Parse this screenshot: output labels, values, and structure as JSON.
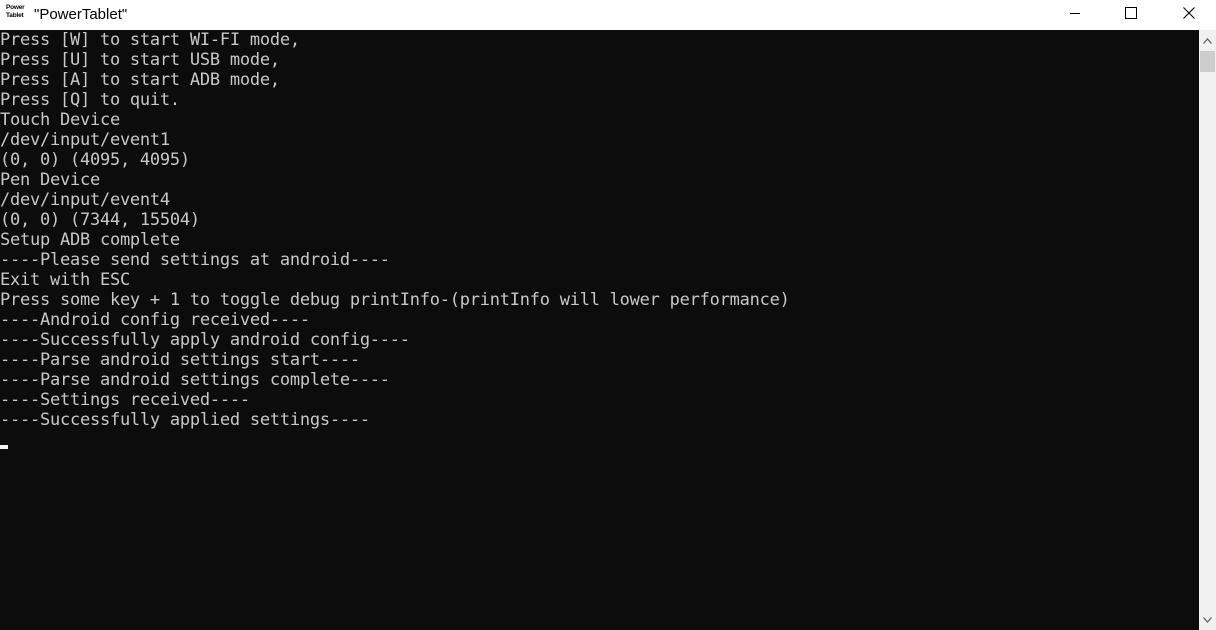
{
  "window": {
    "icon_label": "Power Tablet",
    "title": "\"PowerTablet\""
  },
  "console": {
    "lines": [
      "Press [W] to start WI-FI mode,",
      "Press [U] to start USB mode,",
      "Press [A] to start ADB mode,",
      "Press [Q] to quit.",
      "Touch Device",
      "/dev/input/event1",
      "(0, 0) (4095, 4095)",
      "Pen Device",
      "/dev/input/event4",
      "(0, 0) (7344, 15504)",
      "Setup ADB complete",
      "----Please send settings at android----",
      "Exit with ESC",
      "Press some key + 1 to toggle debug printInfo-(printInfo will lower performance)",
      "----Android config received----",
      "----Successfully apply android config----",
      "----Parse android settings start----",
      "----Parse android settings complete----",
      "----Settings received----",
      "----Successfully applied settings----"
    ]
  },
  "icons": {
    "minimize": "minimize-icon",
    "maximize": "maximize-icon",
    "close": "close-icon",
    "scroll_up": "chevron-up-icon",
    "scroll_down": "chevron-down-icon"
  }
}
